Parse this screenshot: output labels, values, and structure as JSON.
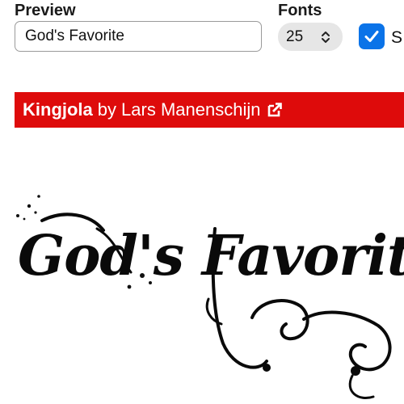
{
  "controls": {
    "preview_label": "Preview",
    "fonts_label": "Fonts",
    "preview_value": "God's Favorite",
    "size_value": "25",
    "checkbox_checked": true,
    "checkbox_label": "S"
  },
  "font_banner": {
    "font_name": "Kingjola",
    "by": "by",
    "designer": "Lars Manenschijn",
    "icon": "external-link-icon",
    "color": "#de0b0b"
  },
  "preview": {
    "rendered_text": "God's Favorite"
  },
  "colors": {
    "accent": "#0a73e8",
    "banner": "#de0b0b"
  }
}
